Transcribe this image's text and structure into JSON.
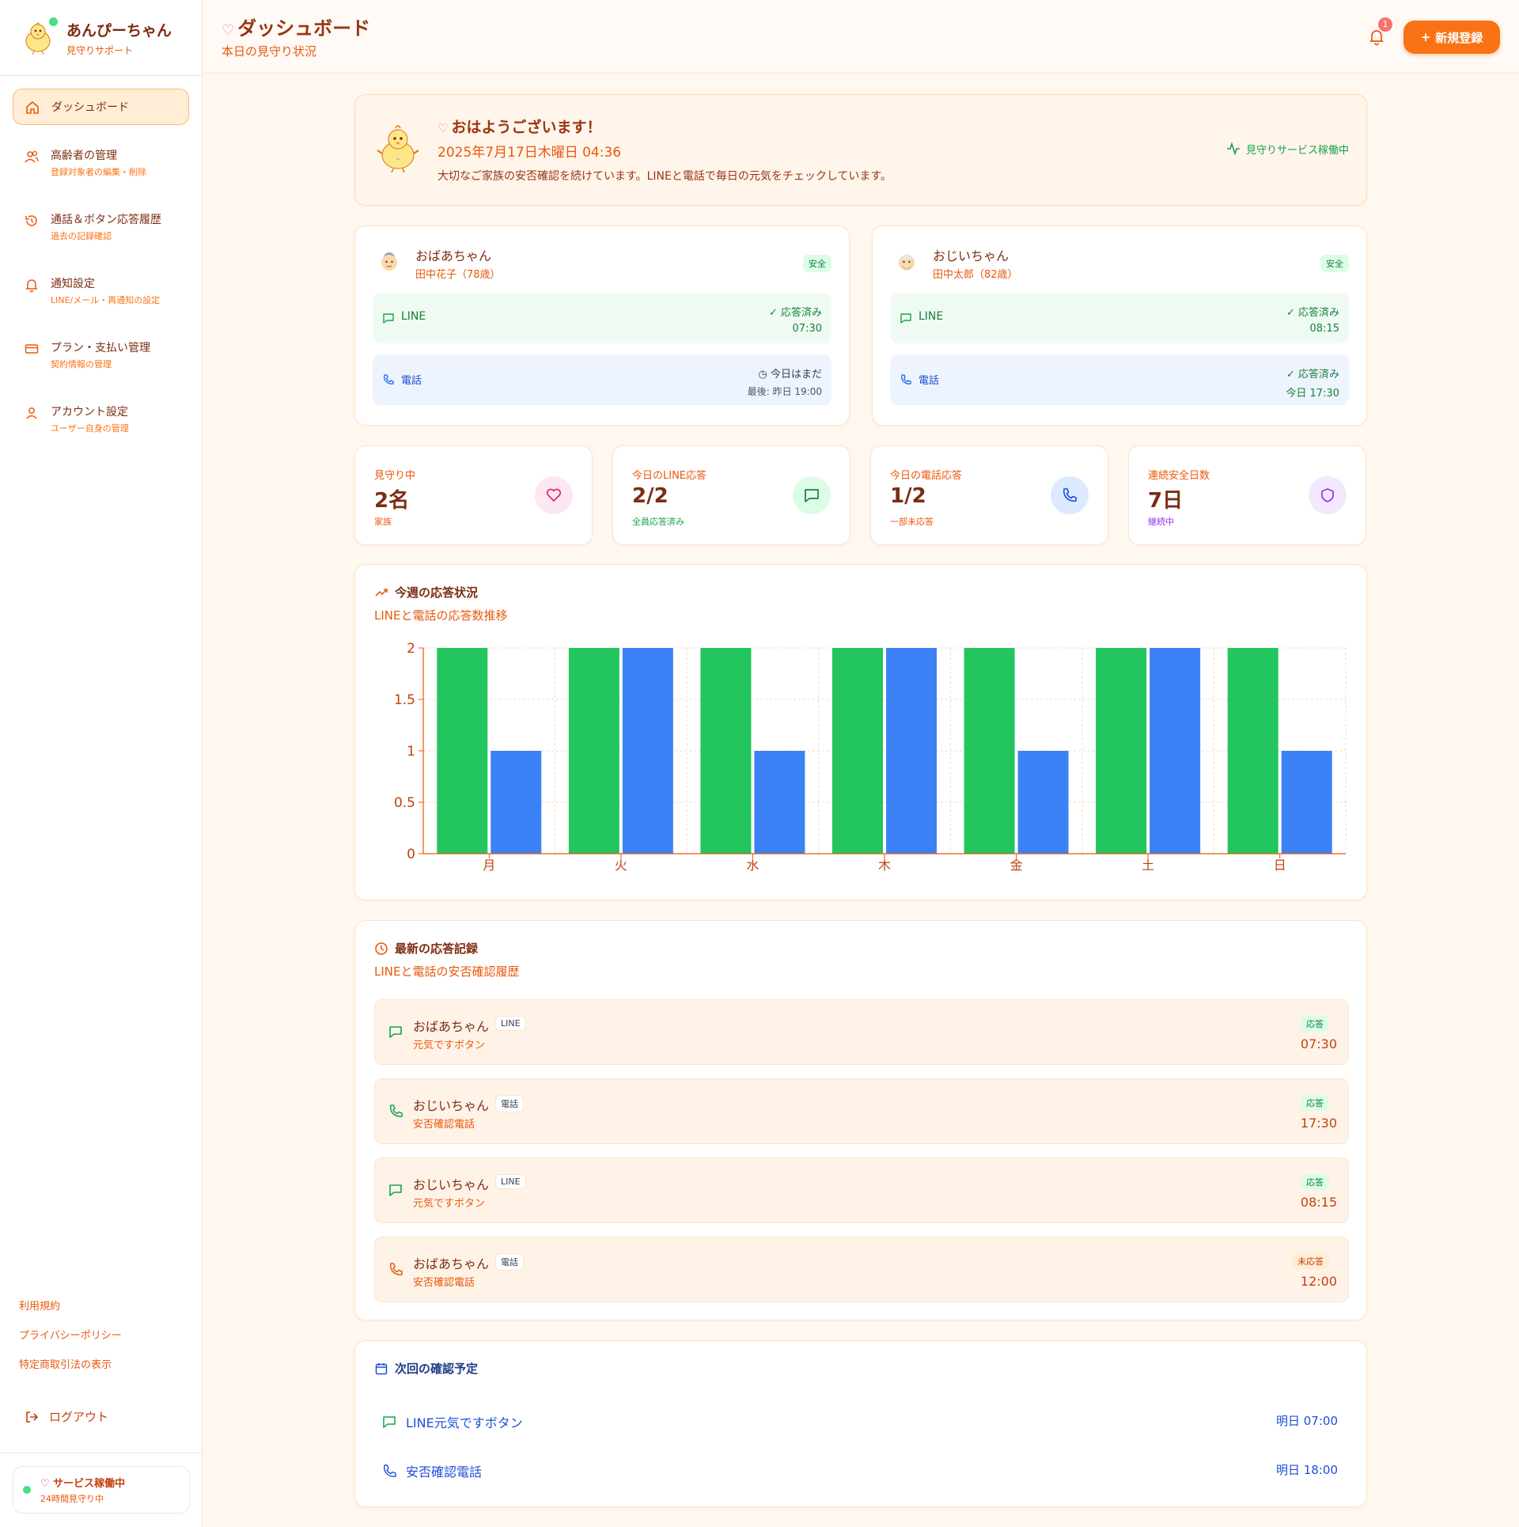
{
  "brand": {
    "title": "あんぴーちゃん",
    "subtitle": "見守りサポート"
  },
  "sidebar": {
    "items": [
      {
        "label": "ダッシュボード",
        "sub": ""
      },
      {
        "label": "高齢者の管理",
        "sub": "登録対象者の編集・削除"
      },
      {
        "label": "通話＆ボタン応答履歴",
        "sub": "過去の記録確認"
      },
      {
        "label": "通知設定",
        "sub": "LINE/メール・再通知の設定"
      },
      {
        "label": "プラン・支払い管理",
        "sub": "契約情報の管理"
      },
      {
        "label": "アカウント設定",
        "sub": "ユーザー自身の管理"
      }
    ],
    "footer_links": [
      "利用規約",
      "プライバシーポリシー",
      "特定商取引法の表示"
    ],
    "logout": "ログアウト",
    "status_title": "♡ サービス稼働中",
    "status_sub": "24時間見守り中"
  },
  "header": {
    "title": "ダッシュボード",
    "subtitle": "本日の見守り状況",
    "notification_count": "1",
    "new_button": "新規登録"
  },
  "greeting": {
    "title": "おはようございます！",
    "date": "2025年7月17日木曜日 04:36",
    "message": "大切なご家族の安否確認を続けています。LINEと電話で毎日の元気をチェックしています。",
    "status": "見守りサービス稼働中"
  },
  "people": [
    {
      "name": "おばあちゃん",
      "full": "田中花子（78歳）",
      "badge": "安全",
      "line_label": "LINE",
      "line_status": "応答済み",
      "line_time": "07:30",
      "phone_label": "電話",
      "phone_status": "今日はまだ",
      "phone_time": "最後: 昨日 19:00"
    },
    {
      "name": "おじいちゃん",
      "full": "田中太郎（82歳）",
      "badge": "安全",
      "line_label": "LINE",
      "line_status": "応答済み",
      "line_time": "08:15",
      "phone_label": "電話",
      "phone_status": "応答済み",
      "phone_time": "今日 17:30"
    }
  ],
  "stats": [
    {
      "label": "見守り中",
      "value": "2名",
      "sub": "家族",
      "color": "#db2777"
    },
    {
      "label": "今日のLINE応答",
      "value": "2/2",
      "sub": "全員応答済み",
      "color": "#16a34a"
    },
    {
      "label": "今日の電話応答",
      "value": "1/2",
      "sub": "一部未応答",
      "color": "#ea580c"
    },
    {
      "label": "連続安全日数",
      "value": "7日",
      "sub": "継続中",
      "color": "#9333ea"
    }
  ],
  "chart_section": {
    "title": "今週の応答状況",
    "subtitle": "LINEと電話の応答数推移"
  },
  "chart_data": {
    "type": "bar",
    "categories": [
      "月",
      "火",
      "水",
      "木",
      "金",
      "土",
      "日"
    ],
    "series": [
      {
        "values": [
          2,
          2,
          2,
          2,
          2,
          2,
          2
        ],
        "color": "#22c55e"
      },
      {
        "values": [
          1,
          2,
          1,
          2,
          1,
          2,
          1
        ],
        "color": "#3b82f6"
      }
    ],
    "yticks": [
      "0",
      "0.5",
      "1",
      "1.5",
      "2"
    ],
    "ylim": [
      0,
      2
    ],
    "grid": true
  },
  "records_section": {
    "title": "最新の応答記録",
    "subtitle": "LINEと電話の安否確認履歴"
  },
  "records": [
    {
      "name": "おばあちゃん",
      "tag": "LINE",
      "sub": "元気ですボタン",
      "badge": "応答",
      "time": "07:30",
      "kind": "line",
      "ok": true
    },
    {
      "name": "おじいちゃん",
      "tag": "電話",
      "sub": "安否確認電話",
      "badge": "応答",
      "time": "17:30",
      "kind": "phone",
      "ok": true
    },
    {
      "name": "おじいちゃん",
      "tag": "LINE",
      "sub": "元気ですボタン",
      "badge": "応答",
      "time": "08:15",
      "kind": "line",
      "ok": true
    },
    {
      "name": "おばあちゃん",
      "tag": "電話",
      "sub": "安否確認電話",
      "badge": "未応答",
      "time": "12:00",
      "kind": "phone",
      "ok": false
    }
  ],
  "next_section": {
    "title": "次回の確認予定"
  },
  "next_items": [
    {
      "label": "LINE元気ですボタン",
      "when": "明日 07:00"
    },
    {
      "label": "安否確認電話",
      "when": "明日 18:00"
    }
  ]
}
